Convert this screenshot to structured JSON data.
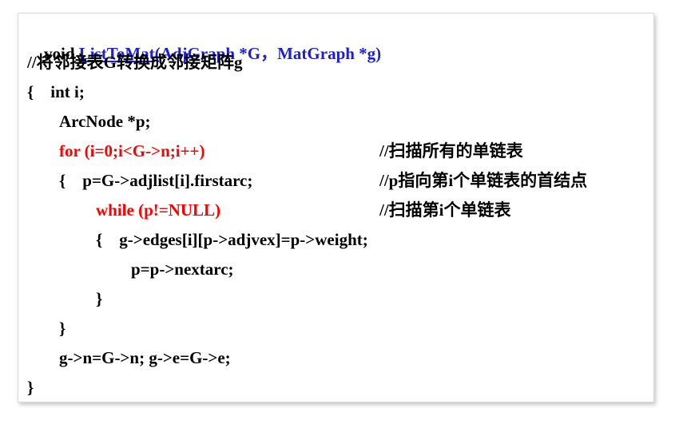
{
  "code": {
    "signature": {
      "keyword": "void ",
      "function_name": "ListToMat",
      "params": "(AdjGraph *G，MatGraph *g)"
    },
    "header_comment": "//将邻接表G转换成邻接矩阵g",
    "line_open_decl": "{    int i;",
    "line_arcnode": "ArcNode *p;",
    "line_for": "for (i=0;i<G->n;i++)",
    "comment_for": "//扫描所有的单链表",
    "line_p_assign": "{    p=G->adjlist[i].firstarc;",
    "comment_p_assign": "//p指向第i个单链表的首结点",
    "line_while": "while (p!=NULL)",
    "comment_while": "//扫描第i个单链表",
    "line_edges": "{    g->edges[i][p->adjvex]=p->weight;",
    "line_nextarc": "p=p->nextarc;",
    "line_close_inner": "}",
    "line_close_for": "}",
    "line_assign_ne": "g->n=G->n; g->e=G->e;",
    "line_close_fn": "}"
  },
  "colors": {
    "keyword_red": "#ff0000",
    "signature_blue": "#1f1fd0",
    "text": "#000000"
  }
}
